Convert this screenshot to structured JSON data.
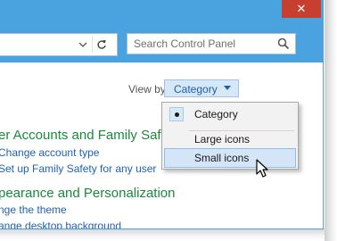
{
  "window": {
    "close_glyph": "✕",
    "accent_color": "#4aa3df",
    "close_color": "#c7402f"
  },
  "address_bar": {
    "search_placeholder": "Search Control Panel",
    "chevron_icon": "chevron-down-icon",
    "refresh_icon": "refresh-icon",
    "search_icon": "search-icon"
  },
  "view_by": {
    "label": "View by:",
    "selected": "Category"
  },
  "categories": [
    {
      "heading": "er Accounts and Family Safe",
      "links": [
        "Change account type",
        "Set up Family Safety for any user"
      ]
    },
    {
      "heading": "pearance and Personalization",
      "links": [
        "nge the theme",
        "ange desktop background"
      ]
    }
  ],
  "dropdown": {
    "items": [
      {
        "label": "Category",
        "checked": true
      },
      {
        "label": "Large icons",
        "checked": false
      },
      {
        "label": "Small icons",
        "checked": false,
        "hovered": true
      }
    ]
  }
}
